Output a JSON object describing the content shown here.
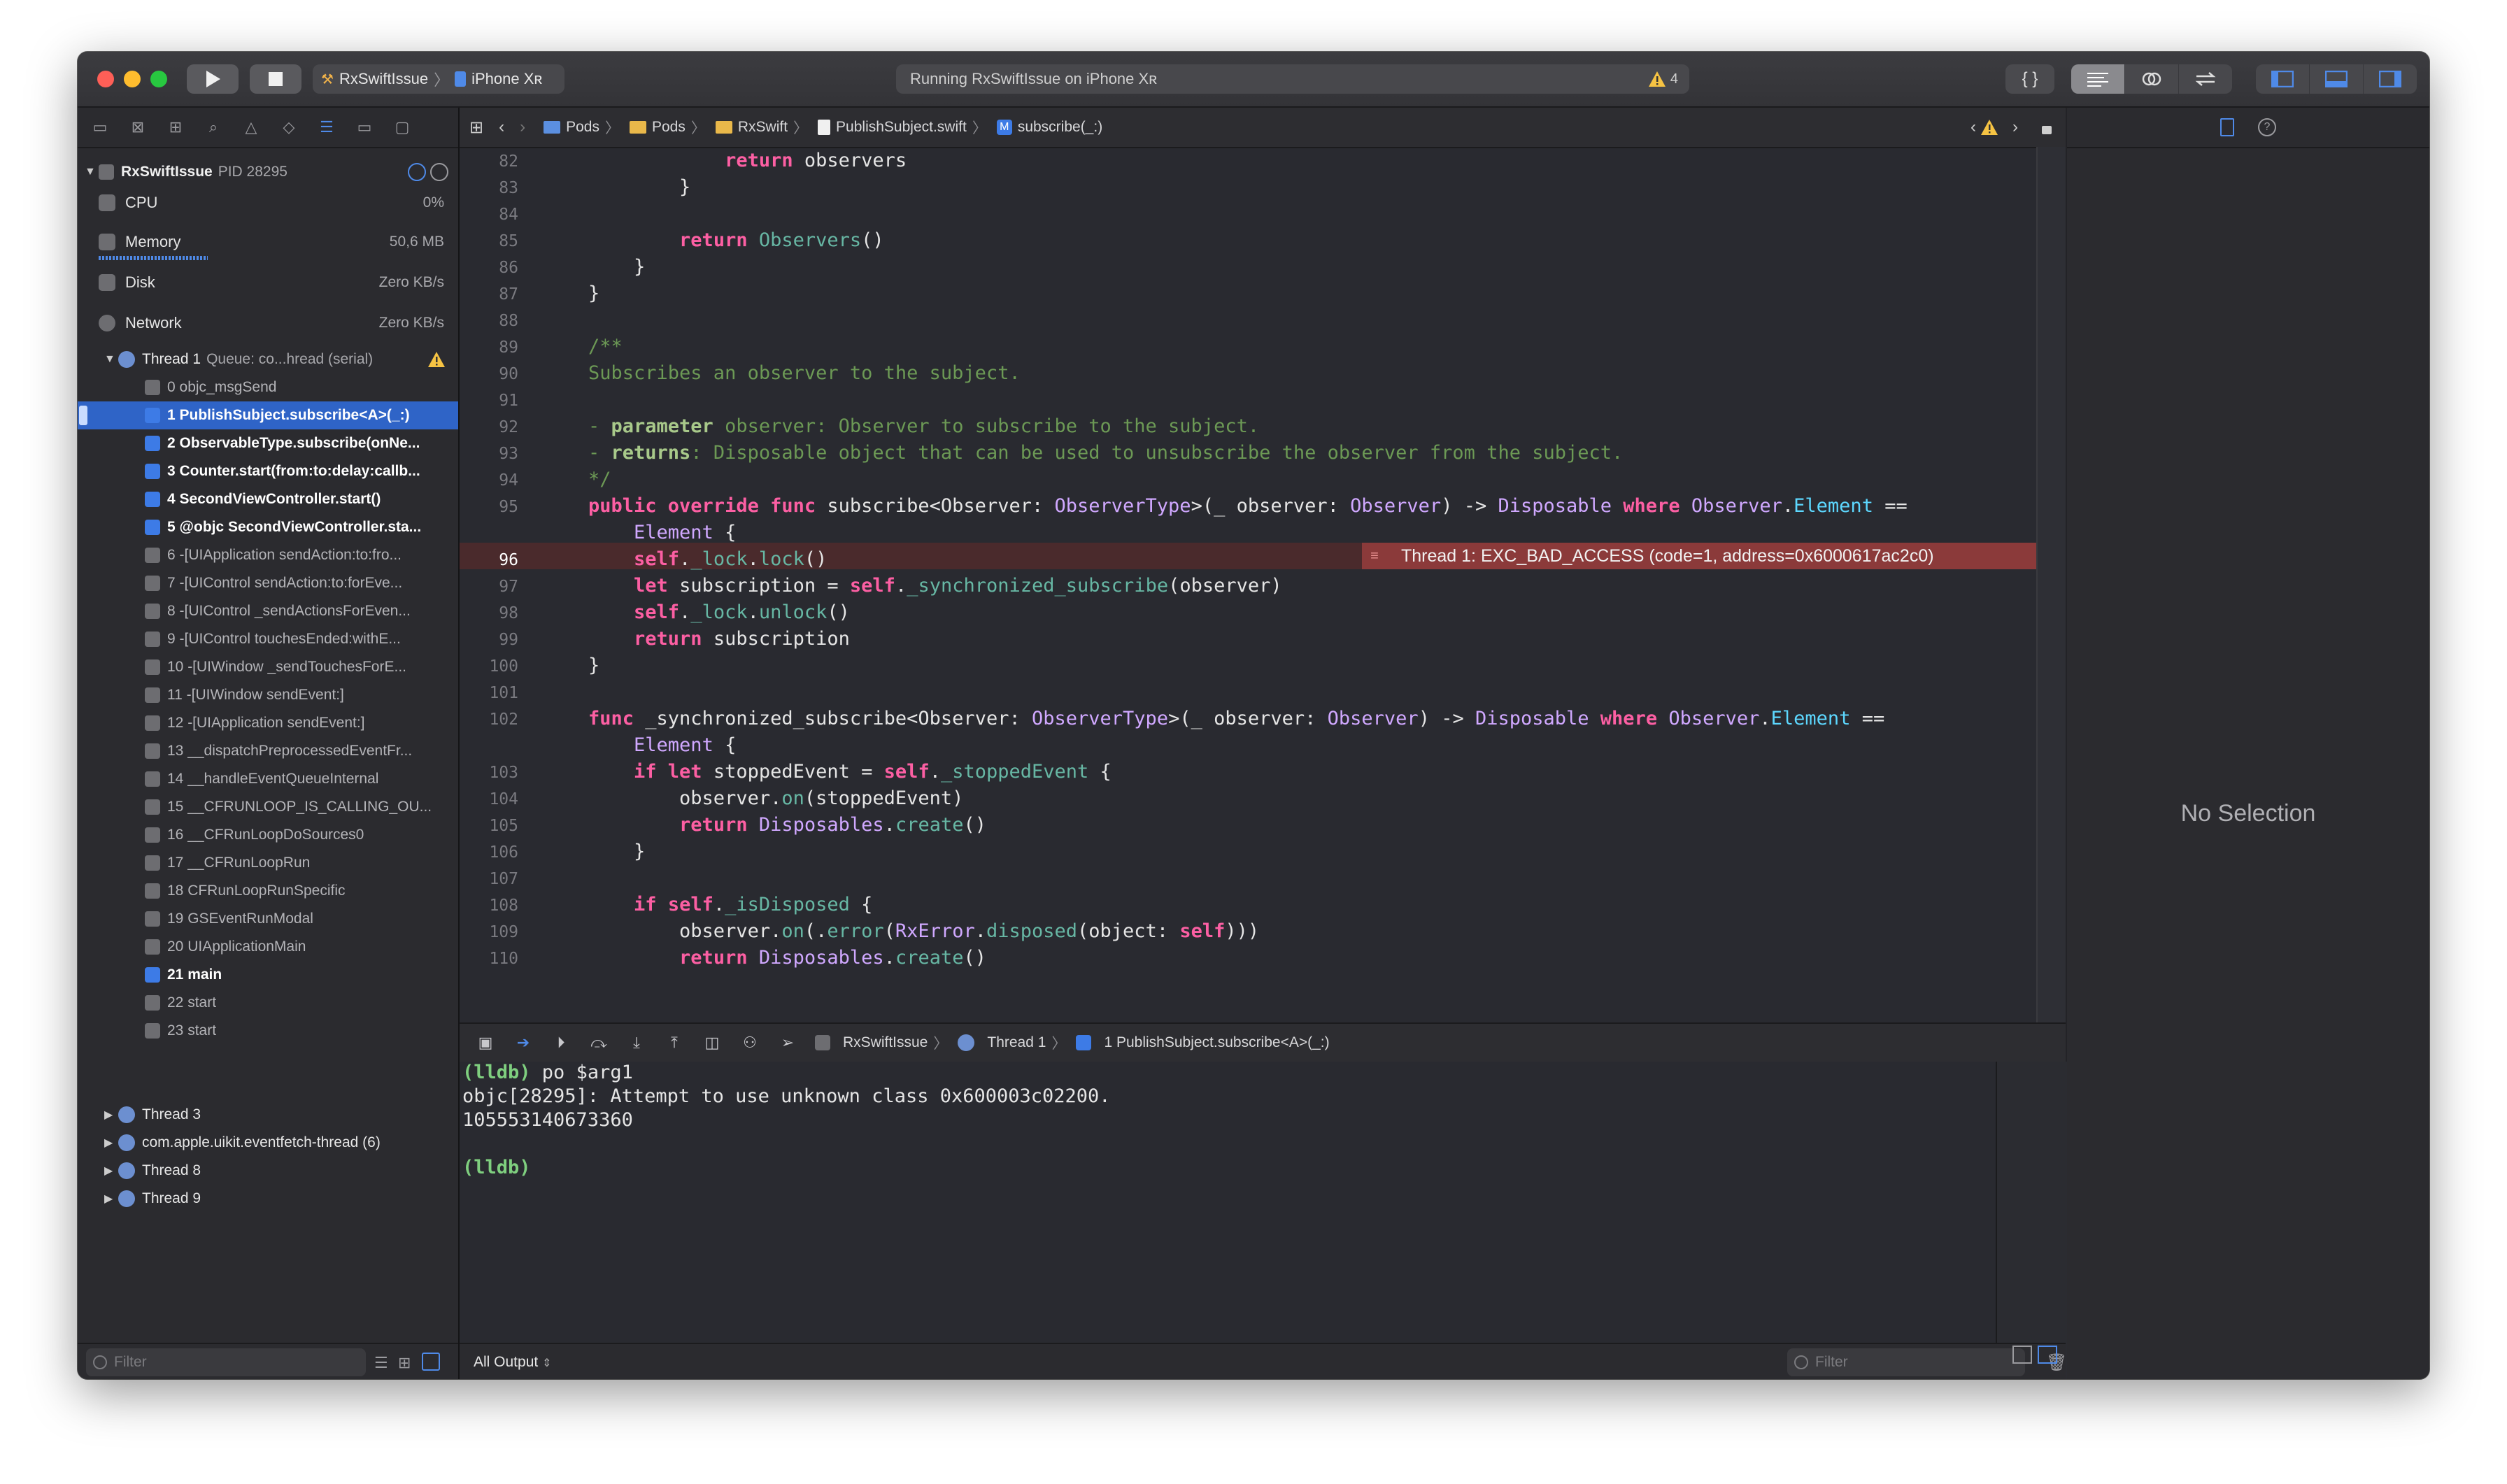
{
  "toolbar": {
    "scheme_target": "RxSwiftIssue",
    "scheme_device": "iPhone Xʀ",
    "activity_text": "Running RxSwiftIssue on iPhone Xʀ",
    "warning_count": "4"
  },
  "debug_nav": {
    "process_name": "RxSwiftIssue",
    "process_pid": "PID 28295",
    "gauges": [
      {
        "label": "CPU",
        "value": "0%"
      },
      {
        "label": "Memory",
        "value": "50,6 MB"
      },
      {
        "label": "Disk",
        "value": "Zero KB/s"
      },
      {
        "label": "Network",
        "value": "Zero KB/s"
      }
    ],
    "thread1_label": "Thread 1",
    "thread1_queue": "Queue: co...hread (serial)",
    "frames": [
      {
        "label": "0 objc_msgSend",
        "kind": "sys"
      },
      {
        "label": "1 PublishSubject.subscribe<A>(_:)",
        "kind": "user"
      },
      {
        "label": "2 ObservableType.subscribe(onNe...",
        "kind": "user"
      },
      {
        "label": "3 Counter.start(from:to:delay:callb...",
        "kind": "user"
      },
      {
        "label": "4 SecondViewController.start()",
        "kind": "user"
      },
      {
        "label": "5 @objc SecondViewController.sta...",
        "kind": "user"
      },
      {
        "label": "6 -[UIApplication sendAction:to:fro...",
        "kind": "sys"
      },
      {
        "label": "7 -[UIControl sendAction:to:forEve...",
        "kind": "sys"
      },
      {
        "label": "8 -[UIControl _sendActionsForEven...",
        "kind": "sys"
      },
      {
        "label": "9 -[UIControl touchesEnded:withE...",
        "kind": "sys"
      },
      {
        "label": "10 -[UIWindow _sendTouchesForE...",
        "kind": "sys"
      },
      {
        "label": "11 -[UIWindow sendEvent:]",
        "kind": "sys"
      },
      {
        "label": "12 -[UIApplication sendEvent:]",
        "kind": "sys"
      },
      {
        "label": "13 __dispatchPreprocessedEventFr...",
        "kind": "sys"
      },
      {
        "label": "14 __handleEventQueueInternal",
        "kind": "sys"
      },
      {
        "label": "15 __CFRUNLOOP_IS_CALLING_OU...",
        "kind": "sys"
      },
      {
        "label": "16 __CFRunLoopDoSources0",
        "kind": "sys"
      },
      {
        "label": "17 __CFRunLoopRun",
        "kind": "sys"
      },
      {
        "label": "18 CFRunLoopRunSpecific",
        "kind": "sys"
      },
      {
        "label": "19 GSEventRunModal",
        "kind": "sys"
      },
      {
        "label": "20 UIApplicationMain",
        "kind": "sys"
      },
      {
        "label": "21 main",
        "kind": "user"
      },
      {
        "label": "22 start",
        "kind": "sys"
      },
      {
        "label": "23 start",
        "kind": "sys"
      }
    ],
    "other_threads": [
      "Thread 3",
      "com.apple.uikit.eventfetch-thread (6)",
      "Thread 8",
      "Thread 9"
    ],
    "filter_placeholder": "Filter"
  },
  "jump_bar": {
    "crumbs": [
      "Pods",
      "Pods",
      "RxSwift",
      "PublishSubject.swift",
      "subscribe(_:)"
    ],
    "method_badge": "M"
  },
  "code": {
    "lines": [
      {
        "n": "82",
        "html": "            <span class=\"kw\">return</span> observers"
      },
      {
        "n": "83",
        "html": "        }"
      },
      {
        "n": "84",
        "html": ""
      },
      {
        "n": "85",
        "html": "        <span class=\"kw\">return</span> <span class=\"fn\">Observers</span>()"
      },
      {
        "n": "86",
        "html": "    }"
      },
      {
        "n": "87",
        "html": "}"
      },
      {
        "n": "88",
        "html": ""
      },
      {
        "n": "89",
        "html": "<span class=\"cm\">/**</span>"
      },
      {
        "n": "90",
        "html": "<span class=\"cm\">Subscribes an observer to the subject.</span>"
      },
      {
        "n": "91",
        "html": ""
      },
      {
        "n": "92",
        "html": "<span class=\"cm\">- </span><span class=\"cmb\">parameter</span><span class=\"cm\"> observer: Observer to subscribe to the subject.</span>"
      },
      {
        "n": "93",
        "html": "<span class=\"cm\">- </span><span class=\"cmb\">returns</span><span class=\"cm\">: Disposable object that can be used to unsubscribe the observer from the subject.</span>"
      },
      {
        "n": "94",
        "html": "<span class=\"cm\">*/</span>"
      },
      {
        "n": "95",
        "html": "<span class=\"kw\">public override func</span> subscribe&lt;Observer: <span class=\"ty\">ObserverType</span>&gt;(_ observer: <span class=\"ty\">Observer</span>) -&gt; <span class=\"ty\">Disposable</span> <span class=\"kw\">where</span> <span class=\"ty\">Observer</span>.<span class=\"pt\">Element</span> =="
      },
      {
        "n": "",
        "html": "    <span class=\"ty\">Element</span> {"
      },
      {
        "n": "96",
        "html": "    <span class=\"kw\">self</span>.<span class=\"fn\">_lock</span>.<span class=\"fn\">lock</span>()"
      },
      {
        "n": "97",
        "html": "    <span class=\"kw\">let</span> subscription = <span class=\"kw\">self</span>.<span class=\"fn\">_synchronized_subscribe</span>(observer)"
      },
      {
        "n": "98",
        "html": "    <span class=\"kw\">self</span>.<span class=\"fn\">_lock</span>.<span class=\"fn\">unlock</span>()"
      },
      {
        "n": "99",
        "html": "    <span class=\"kw\">return</span> subscription"
      },
      {
        "n": "100",
        "html": "}"
      },
      {
        "n": "101",
        "html": ""
      },
      {
        "n": "102",
        "html": "<span class=\"kw\">func</span> _synchronized_subscribe&lt;Observer: <span class=\"ty\">ObserverType</span>&gt;(_ observer: <span class=\"ty\">Observer</span>) -&gt; <span class=\"ty\">Disposable</span> <span class=\"kw\">where</span> <span class=\"ty\">Observer</span>.<span class=\"pt\">Element</span> =="
      },
      {
        "n": "",
        "html": "    <span class=\"ty\">Element</span> {"
      },
      {
        "n": "103",
        "html": "    <span class=\"kw\">if let</span> stoppedEvent = <span class=\"kw\">self</span>.<span class=\"fn\">_stoppedEvent</span> {"
      },
      {
        "n": "104",
        "html": "        observer.<span class=\"fn\">on</span>(stoppedEvent)"
      },
      {
        "n": "105",
        "html": "        <span class=\"kw\">return</span> <span class=\"ty\">Disposables</span>.<span class=\"fn\">create</span>()"
      },
      {
        "n": "106",
        "html": "    }"
      },
      {
        "n": "107",
        "html": ""
      },
      {
        "n": "108",
        "html": "    <span class=\"kw\">if</span> <span class=\"kw\">self</span>.<span class=\"fn\">_isDisposed</span> {"
      },
      {
        "n": "109",
        "html": "        observer.<span class=\"fn\">on</span>(.<span class=\"fn\">error</span>(<span class=\"ty\">RxError</span>.<span class=\"fn\">disposed</span>(object: <span class=\"kw\">self</span>)))"
      },
      {
        "n": "110",
        "html": "        <span class=\"kw\">return</span> <span class=\"ty\">Disposables</span>.<span class=\"fn\">create</span>()"
      }
    ],
    "error_message": "Thread 1: EXC_BAD_ACCESS (code=1, address=0x6000617ac2c0)"
  },
  "debug_bar": {
    "crumbs": [
      "RxSwiftIssue",
      "Thread 1",
      "1 PublishSubject.subscribe<A>(_:)"
    ]
  },
  "console": {
    "lines": [
      {
        "prompt": "(lldb)",
        "text": " po $arg1"
      },
      {
        "prompt": "",
        "text": "objc[28295]: Attempt to use unknown class 0x600003c02200."
      },
      {
        "prompt": "",
        "text": "105553140673360"
      },
      {
        "prompt": "",
        "text": ""
      },
      {
        "prompt": "(lldb)",
        "text": ""
      }
    ],
    "output_selector": "All Output",
    "filter_placeholder": "Filter"
  },
  "inspector": {
    "empty_text": "No Selection"
  }
}
